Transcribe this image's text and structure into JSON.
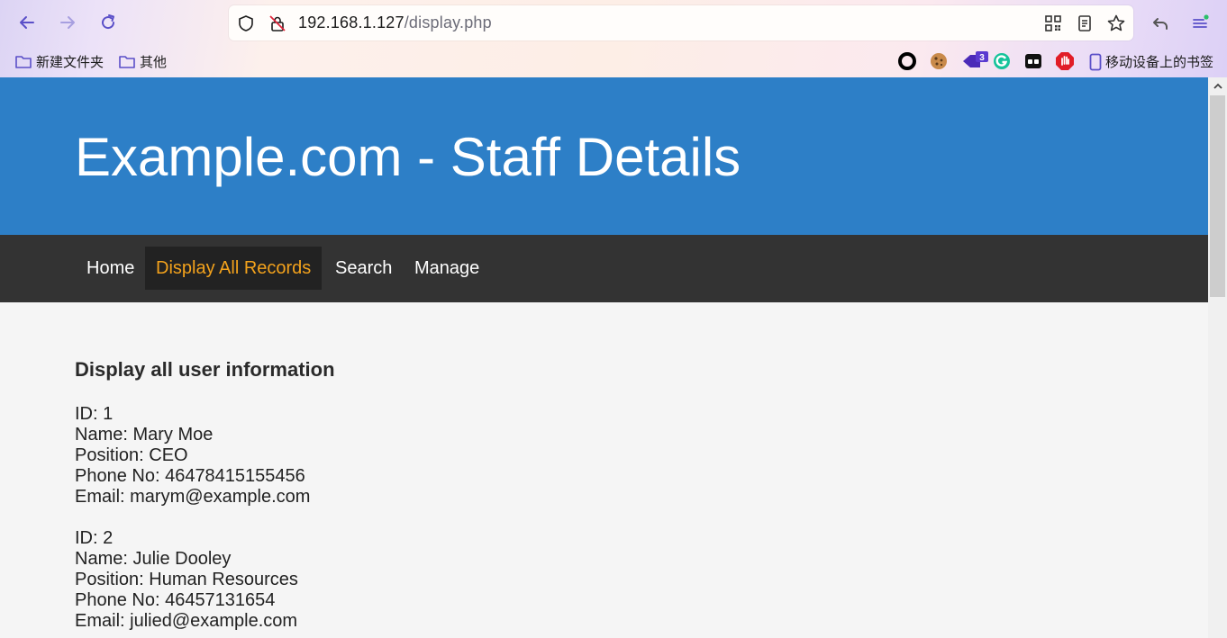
{
  "browser": {
    "url_host": "192.168.1.127",
    "url_path": "/display.php",
    "bookmarks": [
      {
        "label": "新建文件夹",
        "icon": "folder-icon"
      },
      {
        "label": "其他",
        "icon": "folder-icon"
      }
    ],
    "mobile_bookmarks_label": "移动设备上的书签",
    "extension_badge_count": "3"
  },
  "site": {
    "title": "Example.com - Staff Details"
  },
  "nav": {
    "items": [
      {
        "label": "Home",
        "active": false
      },
      {
        "label": "Display All Records",
        "active": true
      },
      {
        "label": "Search",
        "active": false
      },
      {
        "label": "Manage",
        "active": false
      }
    ]
  },
  "main": {
    "heading": "Display all user information",
    "records": [
      {
        "id": "ID: 1",
        "name": "Name: Mary Moe",
        "position": "Position: CEO",
        "phone": "Phone No: 46478415155456",
        "email": "Email: marym@example.com"
      },
      {
        "id": "ID: 2",
        "name": "Name: Julie Dooley",
        "position": "Position: Human Resources",
        "phone": "Phone No: 46457131654",
        "email": "Email: julied@example.com"
      }
    ]
  },
  "colors": {
    "header_blue": "#2d7fc7",
    "nav_dark": "#333333",
    "nav_active_bg": "#222222",
    "nav_active_text": "#f3a21c"
  }
}
